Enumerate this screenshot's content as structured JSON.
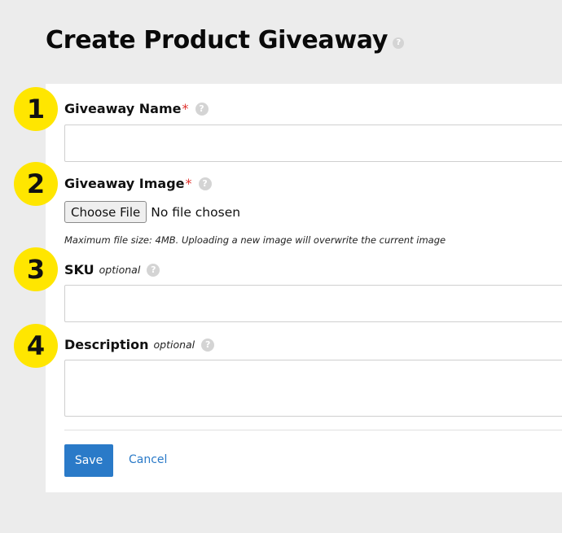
{
  "page": {
    "title": "Create Product Giveaway",
    "help_glyph": "?"
  },
  "steps": [
    "1",
    "2",
    "3",
    "4"
  ],
  "form": {
    "giveaway_name": {
      "label": "Giveaway Name",
      "required_mark": "*",
      "value": ""
    },
    "giveaway_image": {
      "label": "Giveaway Image",
      "required_mark": "*",
      "button_label": "Choose File",
      "status": "No file chosen",
      "hint": "Maximum file size: 4MB. Uploading a new image will overwrite the current image"
    },
    "sku": {
      "label": "SKU",
      "optional_text": "optional",
      "value": ""
    },
    "description": {
      "label": "Description",
      "optional_text": "optional",
      "value": ""
    }
  },
  "actions": {
    "save_label": "Save",
    "cancel_label": "Cancel"
  },
  "colors": {
    "step_badge": "#ffe600",
    "required": "#e0322d",
    "primary": "#2a7ac8",
    "background": "#ececec",
    "help_icon": "#d4d4d4"
  },
  "icons": {
    "help": "question-circle-icon"
  }
}
